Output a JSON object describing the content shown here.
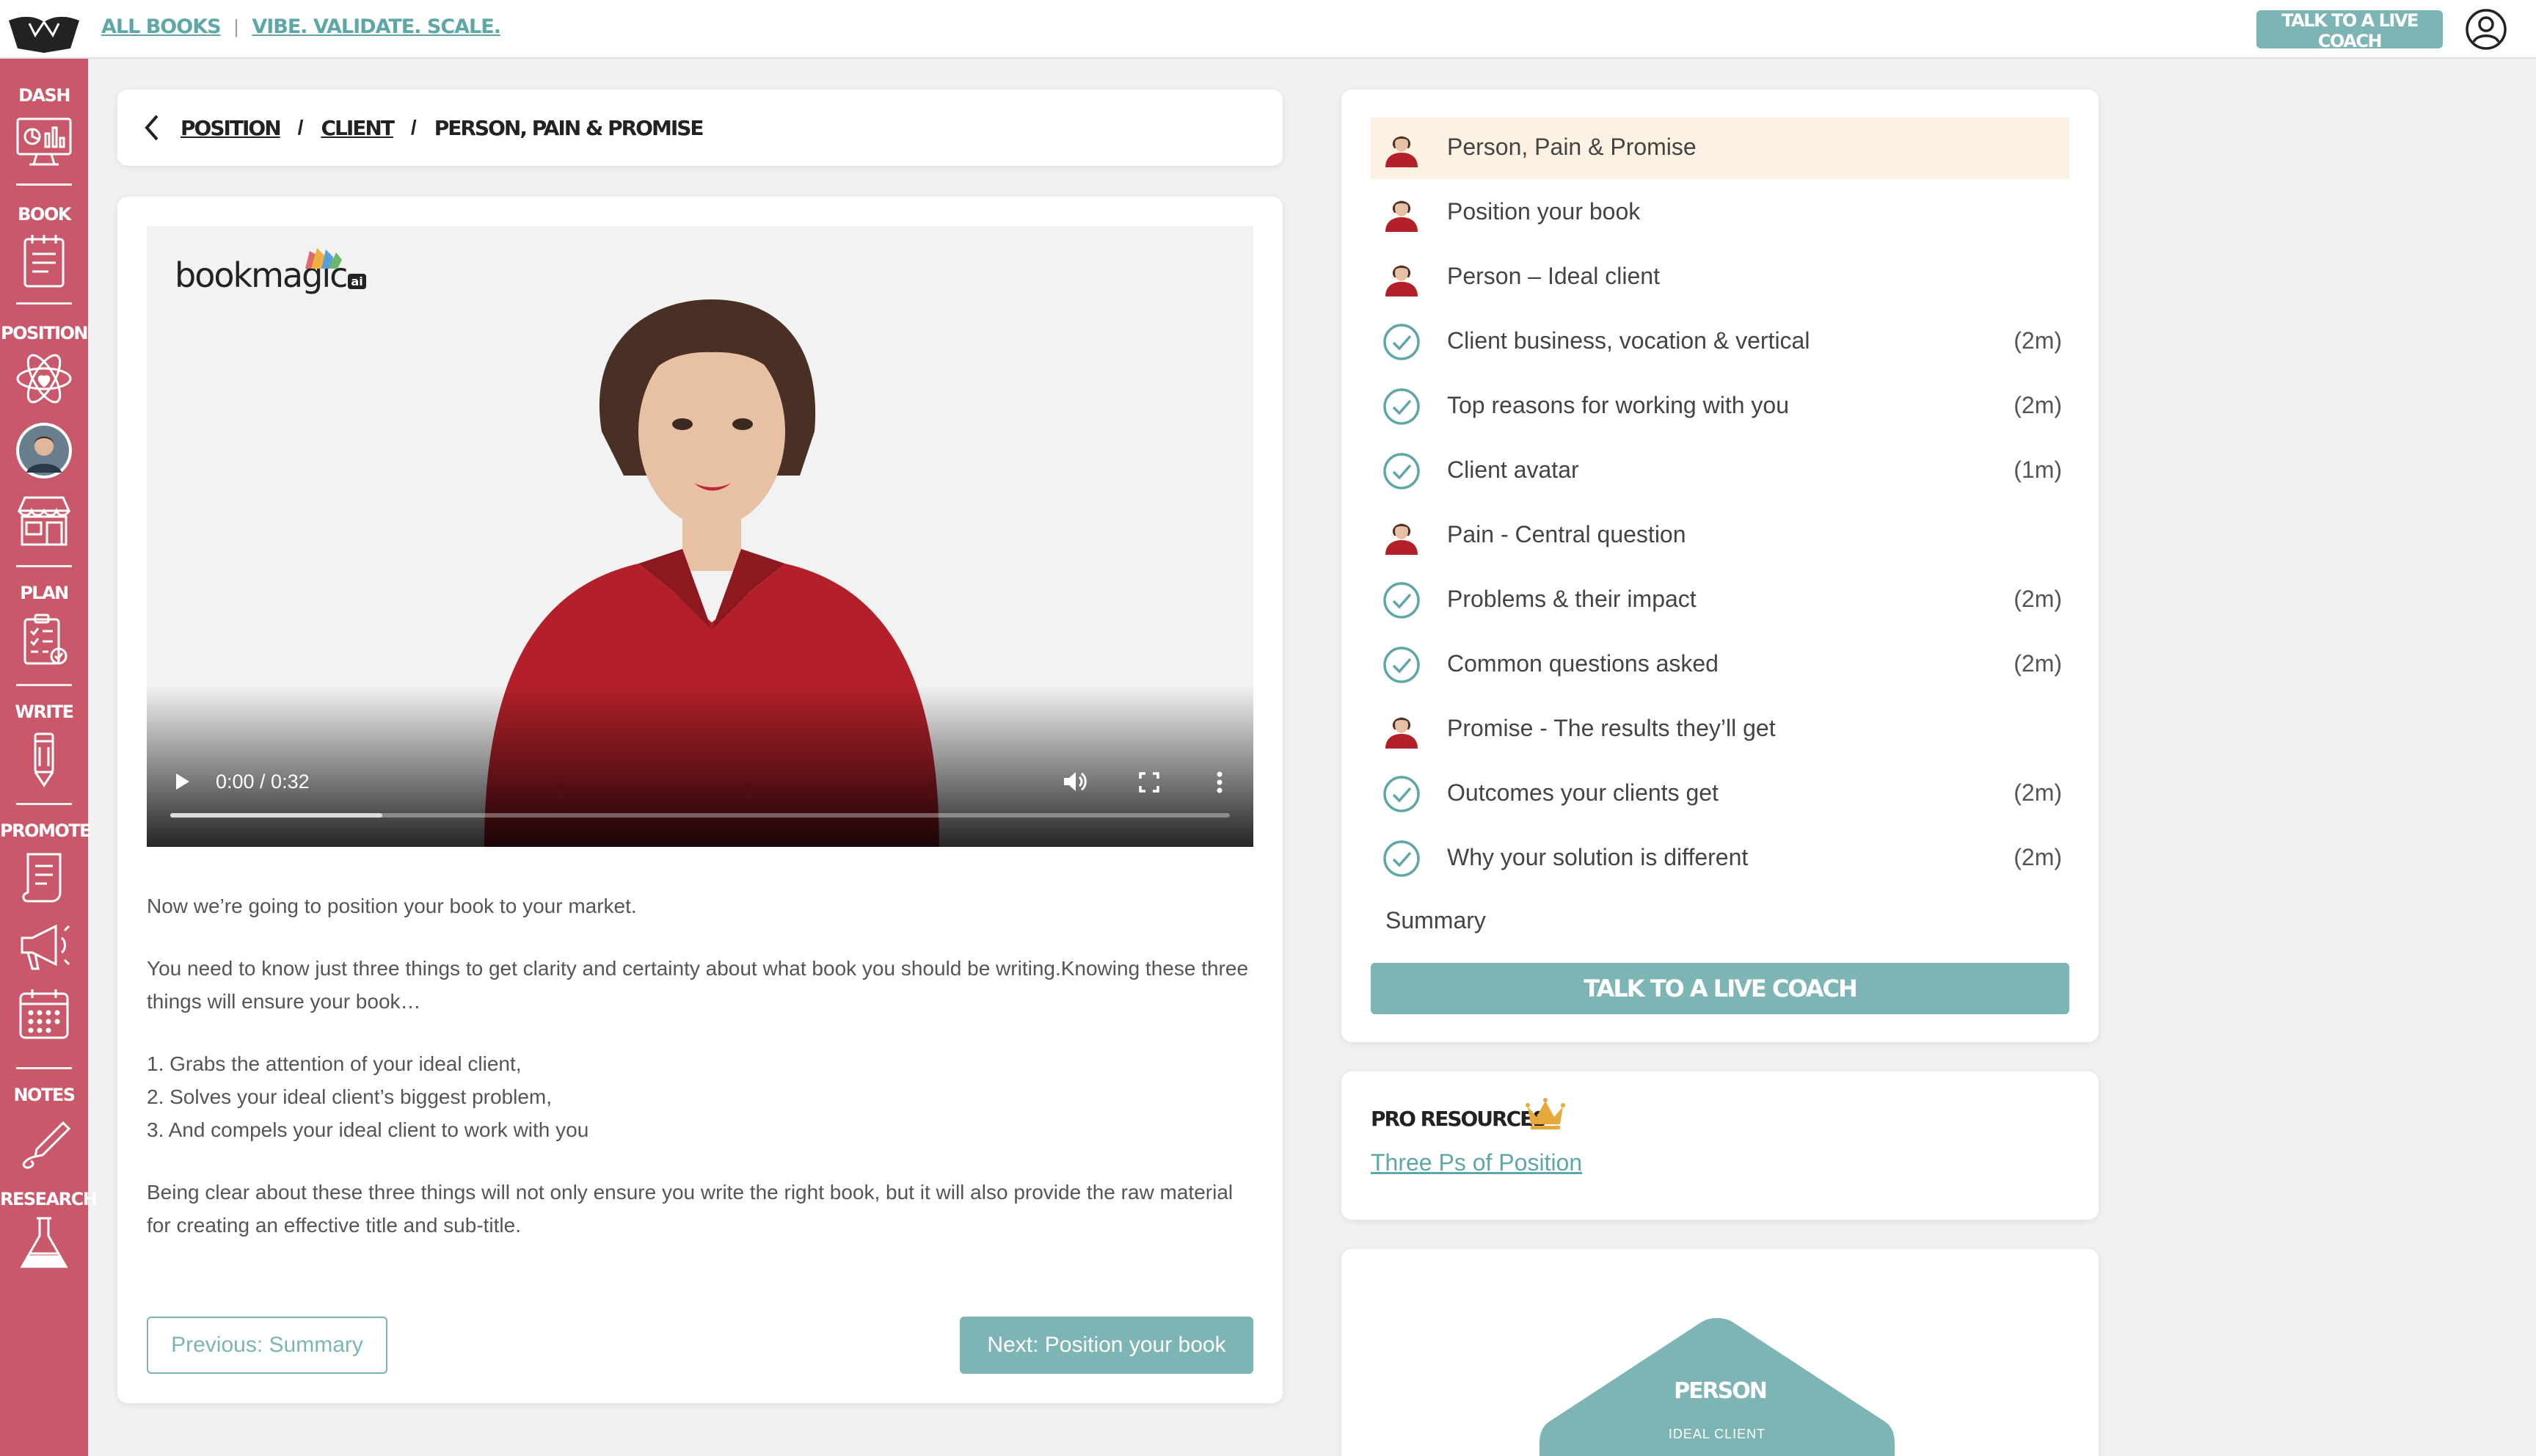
{
  "topbar": {
    "nav": [
      "ALL BOOKS",
      "VIBE. VALIDATE. SCALE."
    ],
    "separator": "|",
    "coach_button": "TALK TO A LIVE COACH"
  },
  "sidebar": {
    "sections": [
      "DASH",
      "BOOK",
      "POSITION",
      "PLAN",
      "WRITE",
      "PROMOTE",
      "NOTES",
      "RESEARCH"
    ]
  },
  "breadcrumb": {
    "items": [
      "POSITION",
      "CLIENT",
      "PERSON, PAIN & PROMISE"
    ],
    "separator": "/"
  },
  "video": {
    "brand": "bookmagic",
    "brand_badge": "ai",
    "time": "0:00 / 0:32",
    "progress": 0.2
  },
  "description": {
    "p1": "Now we’re going to position your book to your market.",
    "p2": "You need to know just three things to get clarity and certainty about what book you should be writing.Knowing these three things will ensure your book…",
    "list": [
      "1. Grabs the attention of your ideal client,",
      "2. Solves your ideal client’s biggest problem,",
      "3. And compels your ideal client to work with you"
    ],
    "p3": "Being clear about these three things will not only ensure you write the right book, but it will also provide the raw material for creating an effective title and sub-title."
  },
  "nav_buttons": {
    "prev": "Previous: Summary",
    "next": "Next: Position your book"
  },
  "steps": [
    {
      "label": "Person, Pain & Promise",
      "type": "video",
      "duration": "",
      "active": true
    },
    {
      "label": "Position your book",
      "type": "video",
      "duration": ""
    },
    {
      "label": "Person – Ideal client",
      "type": "video",
      "duration": ""
    },
    {
      "label": "Client business, vocation & vertical",
      "type": "check",
      "duration": "(2m)"
    },
    {
      "label": "Top reasons for working with you",
      "type": "check",
      "duration": "(2m)"
    },
    {
      "label": "Client avatar",
      "type": "check",
      "duration": "(1m)"
    },
    {
      "label": "Pain - Central question",
      "type": "video",
      "duration": ""
    },
    {
      "label": "Problems & their impact",
      "type": "check",
      "duration": "(2m)"
    },
    {
      "label": "Common questions asked",
      "type": "check",
      "duration": "(2m)"
    },
    {
      "label": "Promise - The results they’ll get",
      "type": "video",
      "duration": ""
    },
    {
      "label": "Outcomes your clients get",
      "type": "check",
      "duration": "(2m)"
    },
    {
      "label": "Why your solution is different",
      "type": "check",
      "duration": "(2m)"
    }
  ],
  "summary_label": "Summary",
  "side_coach_button": "TALK TO A LIVE COACH",
  "pro_resources": {
    "title": "PRO RESOURCES",
    "link": "Three Ps of Position"
  },
  "diagram": {
    "title": "PERSON",
    "subtitle": "IDEAL CLIENT"
  },
  "colors": {
    "sidebar": "#c8586a",
    "accent": "#7db4b4",
    "link": "#5fa7a7",
    "active_step": "#fcf1e2",
    "crown": "#e8a93c"
  }
}
